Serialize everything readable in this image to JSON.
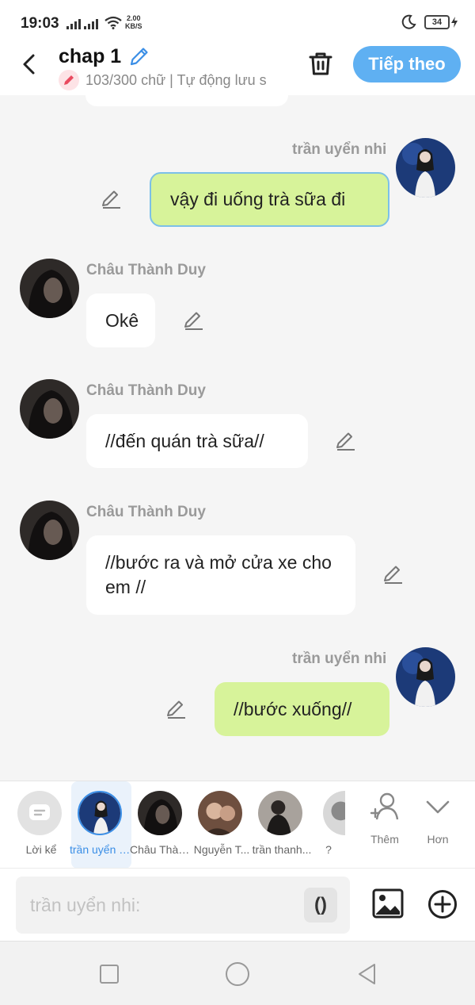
{
  "status_bar": {
    "time": "19:03",
    "net_speed_value": "2.00",
    "net_speed_unit": "KB/S",
    "battery": "34"
  },
  "header": {
    "title": "chap 1",
    "subtitle": "103/300 chữ | Tự động lưu s",
    "next_label": "Tiếp theo"
  },
  "messages": [
    {
      "side": "right",
      "speaker": "trần uyển nhi",
      "text": "vậy đi uống trà sữa đi"
    },
    {
      "side": "left",
      "speaker": "Châu Thành Duy",
      "text": "Okê"
    },
    {
      "side": "left",
      "speaker": "Châu Thành Duy",
      "text": "//đến quán trà sữa//"
    },
    {
      "side": "left",
      "speaker": "Châu Thành Duy",
      "text": "//bước ra và mở cửa xe cho em //"
    },
    {
      "side": "right",
      "speaker": "trần uyển nhi",
      "text": "//bước xuống//"
    }
  ],
  "characters": [
    {
      "label": "Lời kể"
    },
    {
      "label": "trần uyển nhi"
    },
    {
      "label": "Châu Thành Duy"
    },
    {
      "label": "Nguyễn T..."
    },
    {
      "label": "trần thanh..."
    },
    {
      "label": "?"
    }
  ],
  "tools": {
    "add_label": "Thêm",
    "more_label": "Hơn"
  },
  "composer": {
    "placeholder": "trần uyển nhi:",
    "paren_label": "()"
  },
  "colors": {
    "accent": "#5fb0f2",
    "right_bubble": "#d7f39a",
    "left_bubble": "#ffffff",
    "background": "#f5f5f5"
  }
}
